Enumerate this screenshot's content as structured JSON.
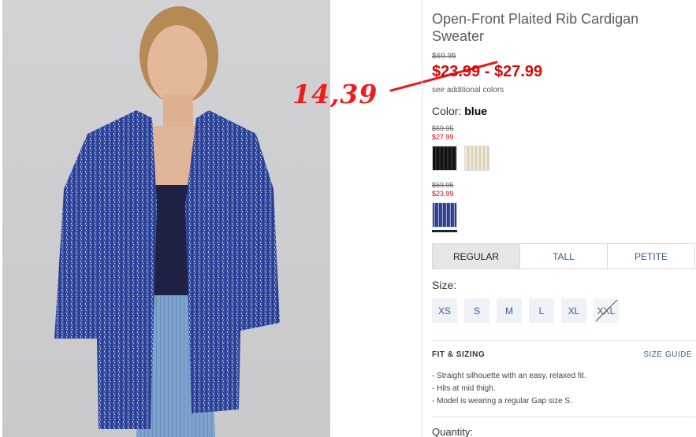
{
  "product": {
    "title": "Open-Front Plaited Rib Cardigan Sweater",
    "original_price": "$69.95",
    "sale_price_range": "$23.99 - $27.99",
    "colors_link": "see additional colors",
    "color_label": "Color:",
    "color_value": "blue"
  },
  "annotation": {
    "text": "14,39",
    "color": "#ee1c1c"
  },
  "swatch_groups": [
    {
      "original": "$69.95",
      "sale": "$27.99",
      "swatches": [
        "black",
        "cream"
      ]
    },
    {
      "original": "$69.95",
      "sale": "$23.99",
      "swatches": [
        "blue"
      ]
    }
  ],
  "fit_tabs": [
    {
      "label": "REGULAR",
      "active": true
    },
    {
      "label": "TALL",
      "active": false
    },
    {
      "label": "PETITE",
      "active": false
    }
  ],
  "size": {
    "label": "Size:",
    "options": [
      {
        "label": "XS",
        "available": true
      },
      {
        "label": "S",
        "available": true
      },
      {
        "label": "M",
        "available": true
      },
      {
        "label": "L",
        "available": true
      },
      {
        "label": "XL",
        "available": true
      },
      {
        "label": "XXL",
        "available": false
      }
    ]
  },
  "fit_sizing": {
    "heading": "FIT & SIZING",
    "guide_link": "SIZE GUIDE",
    "bullets": [
      "- Straight silhouette with an easy, relaxed fit.",
      "- Hits at mid thigh.",
      "- Model is wearing a regular Gap size S."
    ]
  },
  "quantity_label": "Quantity:",
  "colors": {
    "sale_red": "#d10a0a",
    "link_blue": "#3a5a8c",
    "active_tab": "#e6e6e6"
  }
}
